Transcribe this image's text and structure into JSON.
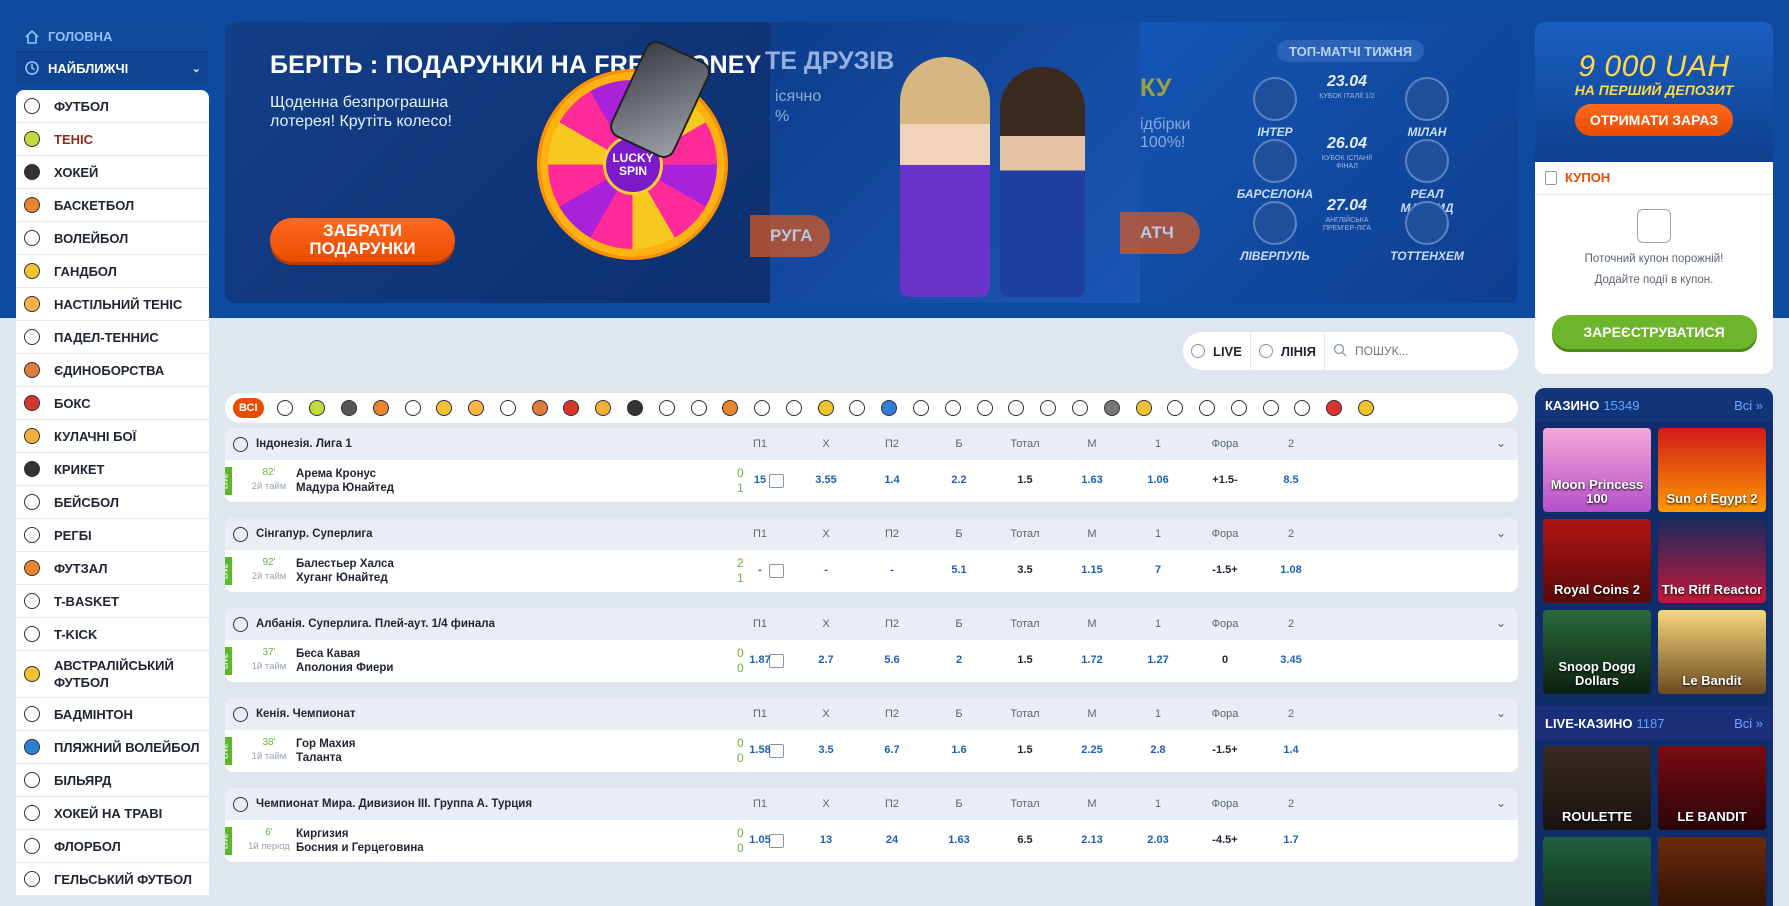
{
  "nav": {
    "home": "ГОЛОВНА",
    "nearest": "НАЙБЛИЖЧІ"
  },
  "sports": [
    "ФУТБОЛ",
    "ТЕНІС",
    "ХОКЕЙ",
    "БАСКЕТБОЛ",
    "ВОЛЕЙБОЛ",
    "ГАНДБОЛ",
    "НАСТІЛЬНИЙ ТЕНІС",
    "ПАДЕЛ-ТЕННИС",
    "ЄДИНОБОРСТВА",
    "БОКС",
    "КУЛАЧНІ БОЇ",
    "КРИКЕТ",
    "БЕЙСБОЛ",
    "РЕГБІ",
    "ФУТЗАЛ",
    "T-BASKET",
    "T-KICK",
    "АВСТРАЛІЙСЬКИЙ ФУТБОЛ",
    "БАДМІНТОН",
    "ПЛЯЖНИЙ ВОЛЕЙБОЛ",
    "БІЛЬЯРД",
    "ХОКЕЙ НА ТРАВІ",
    "ФЛОРБОЛ",
    "ГЕЛЬСЬКИЙ ФУТБОЛ"
  ],
  "banner1": {
    "title": "БЕРІТЬ : ПОДАРУНКИ НА FREE MONEY",
    "text": "Щоденна безпрограшна лотерея! Крутіть колесо!",
    "cta": "ЗАБРАТИ ПОДАРУНКИ",
    "wheel": "LUCKY SPIN"
  },
  "banner2": {
    "title": "ТЕ ДРУЗІВ",
    "line1": "ісячно",
    "line2": "%",
    "cta": "РУГА"
  },
  "banner3": {
    "title": "КУ",
    "line1": "ідбірки",
    "line2": "100%!",
    "cta": "АТЧ",
    "top": "ТОП-МАТЧІ ТИЖНЯ",
    "matches": [
      {
        "home": "ІНТЕР",
        "date": "23.04",
        "cup": "КУБОК ІТАЛІЇ 1/2",
        "away": "МІЛАН"
      },
      {
        "home": "БАРСЕЛОНА",
        "date": "26.04",
        "cup": "КУБОК ІСПАНІЇ ФІНАЛ",
        "away": "РЕАЛ МАДРИД"
      },
      {
        "home": "ЛІВЕРПУЛЬ",
        "date": "27.04",
        "cup": "АНГЛІЙСЬКА ПРЕМ'ЄР-ЛІГА",
        "away": "ТОТТЕНХЕМ"
      }
    ]
  },
  "promo": {
    "amount": "9 000 UAH",
    "sub": "НА ПЕРШИЙ ДЕПОЗИТ",
    "cta": "ОТРИМАТИ ЗАРАЗ"
  },
  "coupon": {
    "title": "КУПОН",
    "msg1": "Поточний купон порожній!",
    "msg2": "Додайте події в купон.",
    "register": "ЗАРЕЄСТРУВАТИСЯ"
  },
  "casino": {
    "title": "КАЗИНО",
    "count": "15349",
    "all": "Всі",
    "games": [
      "Moon Princess 100",
      "Sun of Egypt 2",
      "Royal Coins 2",
      "The Riff Reactor",
      "Snoop Dogg Dollars",
      "Le Bandit"
    ]
  },
  "livecasino": {
    "title": "LIVE-КАЗИНО",
    "count": "1187",
    "all": "Всі",
    "games": [
      "ROULETTE",
      "LE BANDIT",
      "",
      ""
    ]
  },
  "search": {
    "live": "LIVE",
    "line": "ЛІНІЯ",
    "placeholder": "ПОШУК..."
  },
  "sportbar": {
    "all": "ВСІ"
  },
  "columns": [
    "П1",
    "X",
    "П2",
    "Б",
    "Тотал",
    "М",
    "1",
    "Фора",
    "2"
  ],
  "events": [
    {
      "league": "Індонезія. Лига 1",
      "live": "LIVE",
      "time": "82'",
      "period": "2й тайм",
      "home": "Арема Кронус",
      "away": "Мадура Юнайтед",
      "sh": "0",
      "sa": "1",
      "odds": [
        "15",
        "3.55",
        "1.4",
        "2.2",
        "1.5",
        "1.63",
        "1.06",
        "+1.5-",
        "8.5"
      ]
    },
    {
      "league": "Сінгапур. Суперлига",
      "live": "LIVE",
      "time": "92'",
      "period": "2й тайм",
      "home": "Балестьер Халса",
      "away": "Хуганг Юнайтед",
      "sh": "2",
      "sa": "1",
      "odds": [
        "-",
        "-",
        "-",
        "5.1",
        "3.5",
        "1.15",
        "7",
        "-1.5+",
        "1.08"
      ]
    },
    {
      "league": "Албанія. Суперлига. Плей-аут. 1/4 финала",
      "live": "LIVE",
      "time": "37'",
      "period": "1й тайм",
      "home": "Беса Кавая",
      "away": "Аполония Фиери",
      "sh": "0",
      "sa": "0",
      "odds": [
        "1.87",
        "2.7",
        "5.6",
        "2",
        "1.5",
        "1.72",
        "1.27",
        "0",
        "3.45"
      ]
    },
    {
      "league": "Кенія. Чемпионат",
      "live": "LIVE",
      "time": "38'",
      "period": "1й тайм",
      "home": "Гор Махия",
      "away": "Таланта",
      "sh": "0",
      "sa": "0",
      "odds": [
        "1.58",
        "3.5",
        "6.7",
        "1.6",
        "1.5",
        "2.25",
        "2.8",
        "-1.5+",
        "1.4"
      ]
    },
    {
      "league": "Чемпионат Мира. Дивизион III. Группа А. Турция",
      "live": "LIVE",
      "time": "6'",
      "period": "1й період",
      "home": "Киргизия",
      "away": "Босния и Герцеговина",
      "sh": "0",
      "sa": "0",
      "odds": [
        "1.05",
        "13",
        "24",
        "1.63",
        "6.5",
        "2.13",
        "2.03",
        "-4.5+",
        "1.7"
      ]
    }
  ],
  "colors": {
    "brand": "#0d4aa0",
    "accent": "#e94b00",
    "live": "#5ab82a",
    "odds": "#1f5fb3"
  }
}
